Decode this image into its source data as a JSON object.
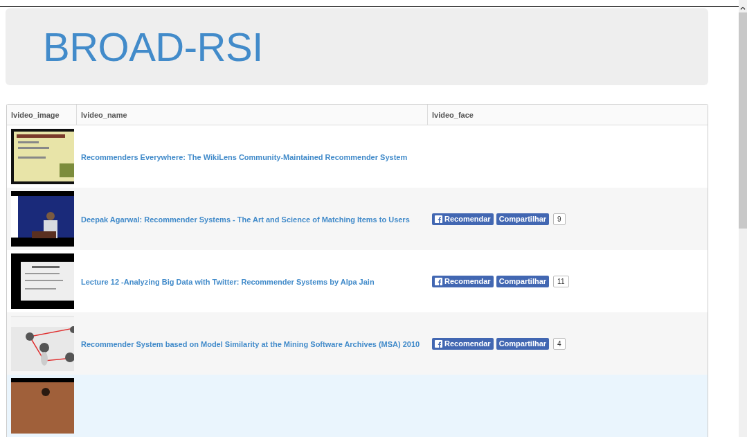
{
  "header": {
    "title": "BROAD-RSI"
  },
  "table": {
    "columns": [
      "lvideo_image",
      "lvideo_name",
      "lvideo_face"
    ],
    "rows": [
      {
        "name": "Recommenders Everywhere: The WikiLens Community-Maintained Recommender System",
        "highlighted": false
      },
      {
        "name": "Deepak Agarwal: Recommender Systems - The Art and Science of Matching Items to Users",
        "highlighted": false,
        "facebook": {
          "like": "Recomendar",
          "share": "Compartilhar",
          "count": "9"
        }
      },
      {
        "name": "Lecture 12 -Analyzing Big Data with Twitter: Recommender Systems by Alpa Jain",
        "highlighted": false,
        "facebook": {
          "like": "Recomendar",
          "share": "Compartilhar",
          "count": "11"
        }
      },
      {
        "name": "Recommender System based on Model Similarity at the Mining Software Archives (MSA) 2010",
        "highlighted": false,
        "facebook": {
          "like": "Recomendar",
          "share": "Compartilhar",
          "count": "4"
        }
      },
      {
        "highlighted": true
      }
    ]
  }
}
